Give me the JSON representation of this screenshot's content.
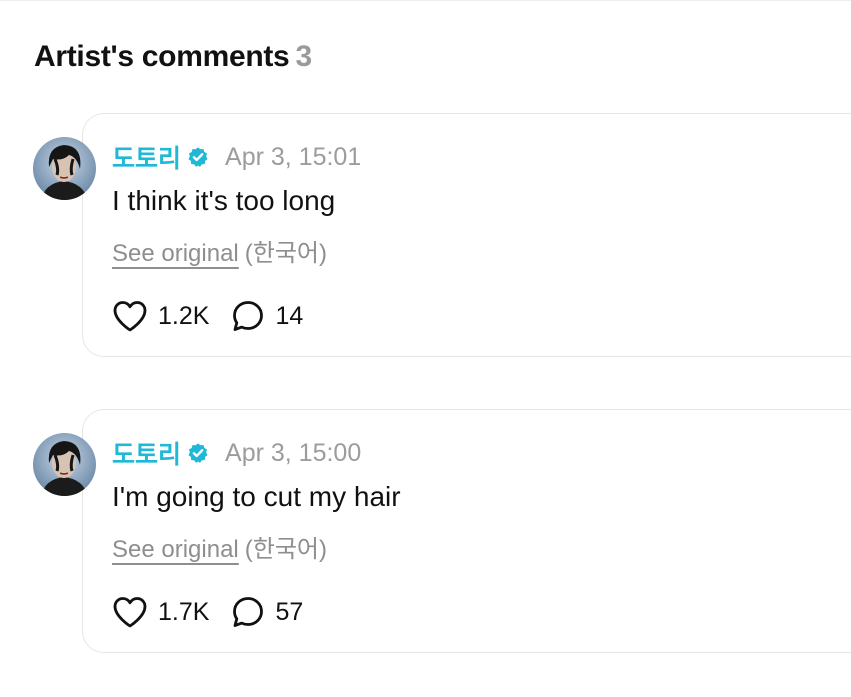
{
  "section": {
    "title": "Artist's comments",
    "count": "3"
  },
  "comments": [
    {
      "author": "도토리",
      "verified": true,
      "timestamp": "Apr 3, 15:01",
      "text": "I think it's too long",
      "see_original": "See original",
      "language": "(한국어)",
      "likes": "1.2K",
      "replies": "14"
    },
    {
      "author": "도토리",
      "verified": true,
      "timestamp": "Apr 3, 15:00",
      "text": "I'm going to cut my hair",
      "see_original": "See original",
      "language": "(한국어)",
      "likes": "1.7K",
      "replies": "57"
    }
  ],
  "icons": {
    "verified": "verified-badge-icon",
    "like": "heart-icon",
    "reply": "comment-bubble-icon"
  },
  "colors": {
    "author": "#1fb8d6",
    "verified_badge": "#1fb8d6",
    "muted": "#9c9c9c"
  }
}
